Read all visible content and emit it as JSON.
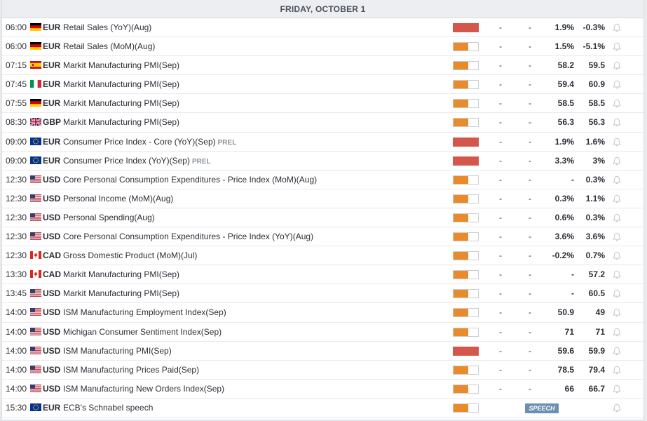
{
  "day_header": "FRIDAY, OCTOBER 1",
  "colors": {
    "high_impact": "#d4574c",
    "medium_impact": "#e98b2a",
    "speech_tag": "#6c8fb0"
  },
  "events": [
    {
      "time": "06:00",
      "flag": "de",
      "currency": "EUR",
      "name": "Retail Sales (YoY)(Aug)",
      "prel": "",
      "impact": "high",
      "actual": "-",
      "deviation": "-",
      "consensus": "1.9%",
      "previous": "-0.3%",
      "tag": ""
    },
    {
      "time": "06:00",
      "flag": "de",
      "currency": "EUR",
      "name": "Retail Sales (MoM)(Aug)",
      "prel": "",
      "impact": "med",
      "actual": "-",
      "deviation": "-",
      "consensus": "1.5%",
      "previous": "-5.1%",
      "tag": ""
    },
    {
      "time": "07:15",
      "flag": "es",
      "currency": "EUR",
      "name": "Markit Manufacturing PMI(Sep)",
      "prel": "",
      "impact": "med",
      "actual": "-",
      "deviation": "-",
      "consensus": "58.2",
      "previous": "59.5",
      "tag": ""
    },
    {
      "time": "07:45",
      "flag": "it",
      "currency": "EUR",
      "name": "Markit Manufacturing PMI(Sep)",
      "prel": "",
      "impact": "med",
      "actual": "-",
      "deviation": "-",
      "consensus": "59.4",
      "previous": "60.9",
      "tag": ""
    },
    {
      "time": "07:55",
      "flag": "de",
      "currency": "EUR",
      "name": "Markit Manufacturing PMI(Sep)",
      "prel": "",
      "impact": "med",
      "actual": "-",
      "deviation": "-",
      "consensus": "58.5",
      "previous": "58.5",
      "tag": ""
    },
    {
      "time": "08:30",
      "flag": "gb",
      "currency": "GBP",
      "name": "Markit Manufacturing PMI(Sep)",
      "prel": "",
      "impact": "med",
      "actual": "-",
      "deviation": "-",
      "consensus": "56.3",
      "previous": "56.3",
      "tag": ""
    },
    {
      "time": "09:00",
      "flag": "eu",
      "currency": "EUR",
      "name": "Consumer Price Index - Core (YoY)(Sep)",
      "prel": "PREL",
      "impact": "high",
      "actual": "-",
      "deviation": "-",
      "consensus": "1.9%",
      "previous": "1.6%",
      "tag": ""
    },
    {
      "time": "09:00",
      "flag": "eu",
      "currency": "EUR",
      "name": "Consumer Price Index (YoY)(Sep)",
      "prel": "PREL",
      "impact": "high",
      "actual": "-",
      "deviation": "-",
      "consensus": "3.3%",
      "previous": "3%",
      "tag": ""
    },
    {
      "time": "12:30",
      "flag": "us",
      "currency": "USD",
      "name": "Core Personal Consumption Expenditures - Price Index (MoM)(Aug)",
      "prel": "",
      "impact": "med",
      "actual": "-",
      "deviation": "-",
      "consensus": "-",
      "previous": "0.3%",
      "tag": ""
    },
    {
      "time": "12:30",
      "flag": "us",
      "currency": "USD",
      "name": "Personal Income (MoM)(Aug)",
      "prel": "",
      "impact": "med",
      "actual": "-",
      "deviation": "-",
      "consensus": "0.3%",
      "previous": "1.1%",
      "tag": ""
    },
    {
      "time": "12:30",
      "flag": "us",
      "currency": "USD",
      "name": "Personal Spending(Aug)",
      "prel": "",
      "impact": "med",
      "actual": "-",
      "deviation": "-",
      "consensus": "0.6%",
      "previous": "0.3%",
      "tag": ""
    },
    {
      "time": "12:30",
      "flag": "us",
      "currency": "USD",
      "name": "Core Personal Consumption Expenditures - Price Index (YoY)(Aug)",
      "prel": "",
      "impact": "med",
      "actual": "-",
      "deviation": "-",
      "consensus": "3.6%",
      "previous": "3.6%",
      "tag": ""
    },
    {
      "time": "12:30",
      "flag": "ca",
      "currency": "CAD",
      "name": "Gross Domestic Product (MoM)(Jul)",
      "prel": "",
      "impact": "med",
      "actual": "-",
      "deviation": "-",
      "consensus": "-0.2%",
      "previous": "0.7%",
      "tag": ""
    },
    {
      "time": "13:30",
      "flag": "ca",
      "currency": "CAD",
      "name": "Markit Manufacturing PMI(Sep)",
      "prel": "",
      "impact": "med",
      "actual": "-",
      "deviation": "-",
      "consensus": "-",
      "previous": "57.2",
      "tag": ""
    },
    {
      "time": "13:45",
      "flag": "us",
      "currency": "USD",
      "name": "Markit Manufacturing PMI(Sep)",
      "prel": "",
      "impact": "med",
      "actual": "-",
      "deviation": "-",
      "consensus": "-",
      "previous": "60.5",
      "tag": ""
    },
    {
      "time": "14:00",
      "flag": "us",
      "currency": "USD",
      "name": "ISM Manufacturing Employment Index(Sep)",
      "prel": "",
      "impact": "med",
      "actual": "-",
      "deviation": "-",
      "consensus": "50.9",
      "previous": "49",
      "tag": ""
    },
    {
      "time": "14:00",
      "flag": "us",
      "currency": "USD",
      "name": "Michigan Consumer Sentiment Index(Sep)",
      "prel": "",
      "impact": "med",
      "actual": "-",
      "deviation": "-",
      "consensus": "71",
      "previous": "71",
      "tag": ""
    },
    {
      "time": "14:00",
      "flag": "us",
      "currency": "USD",
      "name": "ISM Manufacturing PMI(Sep)",
      "prel": "",
      "impact": "high",
      "actual": "-",
      "deviation": "-",
      "consensus": "59.6",
      "previous": "59.9",
      "tag": ""
    },
    {
      "time": "14:00",
      "flag": "us",
      "currency": "USD",
      "name": "ISM Manufacturing Prices Paid(Sep)",
      "prel": "",
      "impact": "med",
      "actual": "-",
      "deviation": "-",
      "consensus": "78.5",
      "previous": "79.4",
      "tag": ""
    },
    {
      "time": "14:00",
      "flag": "us",
      "currency": "USD",
      "name": "ISM Manufacturing New Orders Index(Sep)",
      "prel": "",
      "impact": "med",
      "actual": "-",
      "deviation": "-",
      "consensus": "66",
      "previous": "66.7",
      "tag": ""
    },
    {
      "time": "15:30",
      "flag": "eu",
      "currency": "EUR",
      "name": "ECB's Schnabel speech",
      "prel": "",
      "impact": "med",
      "actual": "",
      "deviation": "",
      "consensus": "",
      "previous": "",
      "tag": "SPEECH"
    }
  ]
}
